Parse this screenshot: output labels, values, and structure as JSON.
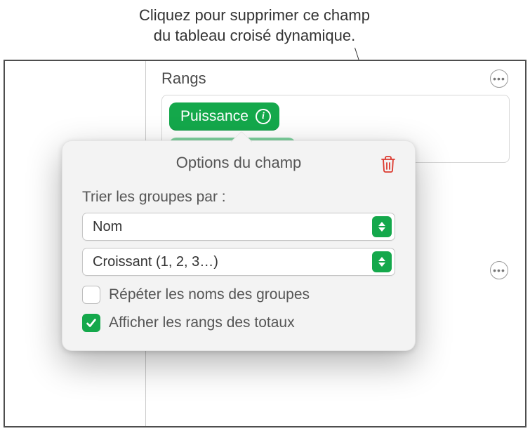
{
  "callout": {
    "line1": "Cliquez pour supprimer ce champ",
    "line2": "du tableau croisé dynamique."
  },
  "panel": {
    "section_title": "Rangs",
    "chip": {
      "label": "Puissance",
      "info_glyph": "i"
    }
  },
  "popover": {
    "title": "Options du champ",
    "group_label": "Trier les groupes par :",
    "sort_field": "Nom",
    "sort_order": "Croissant (1, 2, 3…)",
    "repeat_label": "Répéter les noms des groupes",
    "repeat_checked": false,
    "totals_label": "Afficher les rangs des totaux",
    "totals_checked": true
  },
  "icons": {
    "trash": "trash-icon",
    "more": "more-icon",
    "info": "info-icon",
    "stepper": "updown-icon",
    "checkmark": "checkmark-icon"
  }
}
